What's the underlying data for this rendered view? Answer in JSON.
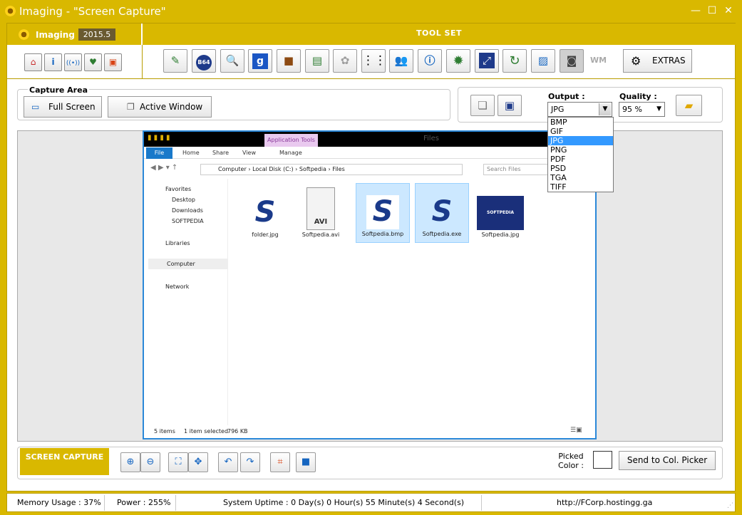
{
  "window": {
    "title": "Imaging - \"Screen Capture\"",
    "minimize": "—",
    "maximize": "☐",
    "close": "✕"
  },
  "brand": {
    "name": "Imaging",
    "version": "2015.5"
  },
  "toolset": {
    "title": "TOOL SET",
    "extras_label": "EXTRAS",
    "b64_label": "B64",
    "wm_label": "WM"
  },
  "capture": {
    "title": "Capture Area",
    "full_screen": "Full Screen",
    "active_window": "Active Window"
  },
  "output": {
    "label": "Output :",
    "selected": "JPG",
    "options": [
      "BMP",
      "GIF",
      "JPG",
      "PNG",
      "PDF",
      "PSD",
      "TGA",
      "TIFF"
    ],
    "quality_label": "Quality :",
    "quality_value": "95 %"
  },
  "explorer": {
    "app_tools": "Application Tools",
    "title": "Files",
    "ribbon": [
      "File",
      "Home",
      "Share",
      "View",
      "Manage"
    ],
    "crumbs": [
      "Computer",
      "Local Disk (C:)",
      "Softpedia",
      "Files"
    ],
    "search_placeholder": "Search Files",
    "nav": [
      "Favorites",
      "Desktop",
      "Downloads",
      "SOFTPEDIA",
      "Libraries",
      "Computer",
      "Network"
    ],
    "files": [
      {
        "name": "folder.jpg",
        "kind": "s"
      },
      {
        "name": "Softpedia.avi",
        "kind": "avi"
      },
      {
        "name": "Softpedia.bmp",
        "kind": "s"
      },
      {
        "name": "Softpedia.exe",
        "kind": "s"
      },
      {
        "name": "Softpedia.jpg",
        "kind": "brand"
      }
    ],
    "avi_label": "AVI",
    "brand_tile": "SOFTPEDIA",
    "status_count": "5 items",
    "status_selected": "1 item selected",
    "status_size": "796 KB"
  },
  "bottom": {
    "screen_capture": "SCREEN CAPTURE",
    "picked_color_label": "Picked Color :",
    "send_button": "Send to Col. Picker"
  },
  "status": {
    "memory": "Memory Usage : 37%",
    "power": "Power : 255%",
    "uptime": "System Uptime : 0 Day(s) 0 Hour(s) 55 Minute(s) 4 Second(s)",
    "url": "http://FCorp.hostingg.ga"
  },
  "colors": {
    "accent": "#d9b800",
    "selection": "#3399ff",
    "explorer_border": "#2b88d8"
  }
}
